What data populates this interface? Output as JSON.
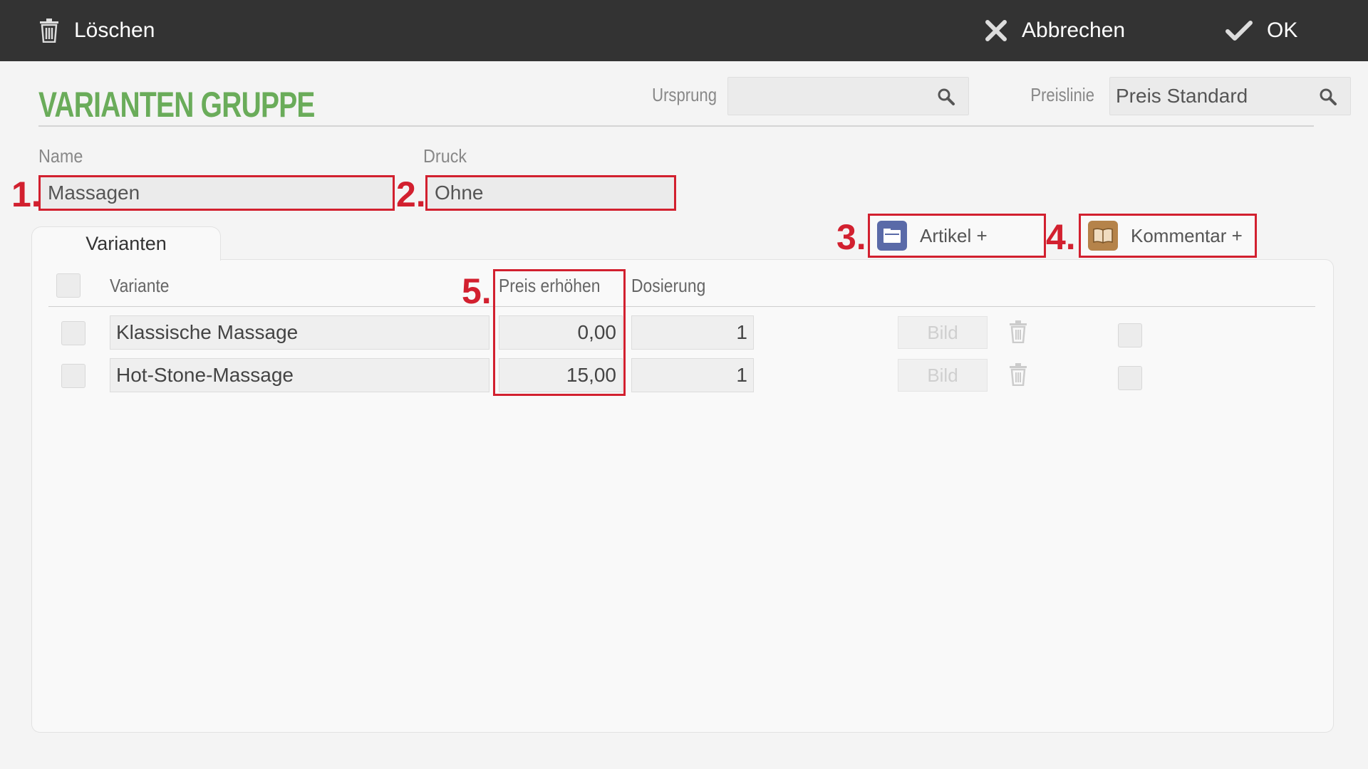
{
  "toolbar": {
    "delete_label": "Löschen",
    "cancel_label": "Abbrechen",
    "ok_label": "OK"
  },
  "header": {
    "title": "VARIANTEN GRUPPE",
    "origin_label": "Ursprung",
    "origin_value": "",
    "pricelist_label": "Preislinie",
    "pricelist_value": "Preis Standard"
  },
  "form": {
    "name_label": "Name",
    "name_value": "Massagen",
    "print_label": "Druck",
    "print_value": "Ohne"
  },
  "markers": [
    "1.",
    "2.",
    "3.",
    "4.",
    "5."
  ],
  "tabs": [
    {
      "label": "Varianten"
    }
  ],
  "actions": {
    "article_label": "Artikel +",
    "comment_label": "Kommentar +"
  },
  "table": {
    "headers": {
      "variant": "Variante",
      "price_increase": "Preis erhöhen",
      "dosage": "Dosierung"
    },
    "rows": [
      {
        "variant": "Klassische Massage",
        "price": "0,00",
        "dosage": "1",
        "image_label": "Bild"
      },
      {
        "variant": "Hot-Stone-Massage",
        "price": "15,00",
        "dosage": "1",
        "image_label": "Bild"
      }
    ]
  },
  "colors": {
    "toolbar_bg": "#333333",
    "title_green": "#6aac5a",
    "highlight_red": "#d2202f",
    "article_icon": "#5a6aa8",
    "comment_icon": "#b5834a"
  },
  "icons": {
    "delete": "trash-icon",
    "cancel": "close-icon",
    "ok": "check-icon",
    "search": "search-icon",
    "article": "folder-icon",
    "comment": "book-icon"
  }
}
